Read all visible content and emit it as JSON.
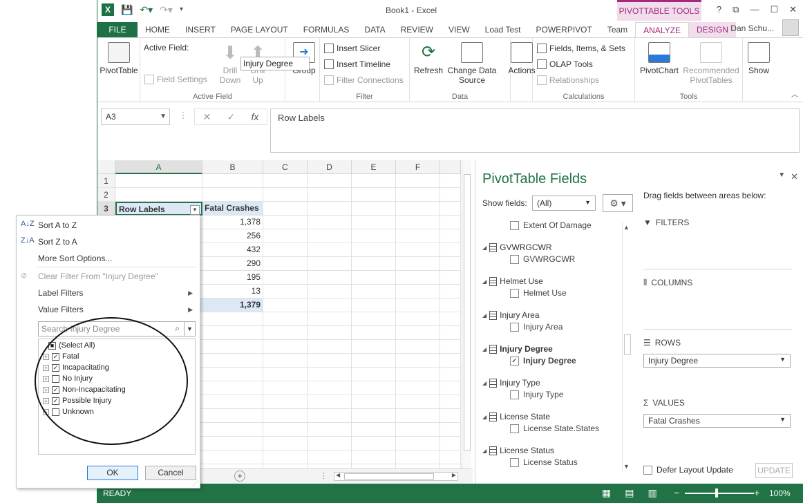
{
  "app": {
    "document_title": "Book1 - Excel",
    "context_band": "PIVOTTABLE TOOLS",
    "user": "Dan Schu...",
    "window_controls": [
      "?",
      "⧉",
      "—",
      "☐",
      "✕"
    ]
  },
  "tabs": [
    "FILE",
    "HOME",
    "INSERT",
    "PAGE LAYOUT",
    "FORMULAS",
    "DATA",
    "REVIEW",
    "VIEW",
    "Load Test",
    "POWERPIVOT",
    "Team",
    "ANALYZE",
    "DESIGN"
  ],
  "ribbon": {
    "pivottable_btn": "PivotTable",
    "active_field_label": "Active Field:",
    "active_field_value": "Injury Degree",
    "field_settings": "Field Settings",
    "drill_down": "Drill Down",
    "drill_up": "Drill Up",
    "active_field_group": "Active Field",
    "group_btn": "Group",
    "insert_slicer": "Insert Slicer",
    "insert_timeline": "Insert Timeline",
    "filter_connections": "Filter Connections",
    "filter_group": "Filter",
    "refresh": "Refresh",
    "change_data_source": "Change Data Source",
    "data_group": "Data",
    "actions": "Actions",
    "fields_items_sets": "Fields, Items, & Sets",
    "olap_tools": "OLAP Tools",
    "relationships": "Relationships",
    "calculations_group": "Calculations",
    "pivotchart": "PivotChart",
    "recommended_pivottables": "Recommended PivotTables",
    "tools_group": "Tools",
    "show": "Show"
  },
  "formula_bar": {
    "name_box": "A3",
    "formula": "Row Labels"
  },
  "grid": {
    "columns": [
      "A",
      "B",
      "C",
      "D",
      "E",
      "F"
    ],
    "rows": [
      "1",
      "2",
      "3"
    ],
    "a3": "Row Labels",
    "b3": "Fatal Crashes",
    "values": [
      "1,378",
      "256",
      "432",
      "290",
      "195",
      "13"
    ],
    "total": "1,379"
  },
  "status": {
    "text": "READY",
    "zoom": "100%"
  },
  "pane": {
    "title": "PivotTable Fields",
    "show_fields_label": "Show fields:",
    "show_fields_value": "(All)",
    "drag_label": "Drag fields between areas below:",
    "fields": [
      {
        "group": "",
        "field": "Extent Of Damage",
        "checked": false,
        "bold": false
      },
      {
        "group": "GVWRGCWR",
        "field": "GVWRGCWR",
        "checked": false,
        "bold": false
      },
      {
        "group": "Helmet Use",
        "field": "Helmet Use",
        "checked": false,
        "bold": false
      },
      {
        "group": "Injury Area",
        "field": "Injury Area",
        "checked": false,
        "bold": false
      },
      {
        "group": "Injury Degree",
        "field": "Injury Degree",
        "checked": true,
        "bold": true
      },
      {
        "group": "Injury Type",
        "field": "Injury Type",
        "checked": false,
        "bold": false
      },
      {
        "group": "License State",
        "field": "License State.States",
        "checked": false,
        "bold": false
      },
      {
        "group": "License Status",
        "field": "License Status",
        "checked": false,
        "bold": false
      }
    ],
    "areas": {
      "filters": "FILTERS",
      "columns": "COLUMNS",
      "rows": "ROWS",
      "rows_item": "Injury Degree",
      "values": "VALUES",
      "values_item": "Fatal Crashes"
    },
    "defer_label": "Defer Layout Update",
    "update_btn": "UPDATE"
  },
  "filter_menu": {
    "sort_az": "Sort A to Z",
    "sort_za": "Sort Z to A",
    "more_sort": "More Sort Options...",
    "clear_filter": "Clear Filter From \"Injury Degree\"",
    "label_filters": "Label Filters",
    "value_filters": "Value Filters",
    "search_placeholder": "Search Injury Degree",
    "items": [
      {
        "label": "(Select All)",
        "state": "partial"
      },
      {
        "label": "Fatal",
        "state": "checked"
      },
      {
        "label": "Incapacitating",
        "state": "checked"
      },
      {
        "label": "No Injury",
        "state": "unchecked"
      },
      {
        "label": "Non-Incapacitating",
        "state": "checked"
      },
      {
        "label": "Possible Injury",
        "state": "checked"
      },
      {
        "label": "Unknown",
        "state": "unchecked"
      }
    ],
    "ok": "OK",
    "cancel": "Cancel"
  },
  "colors": {
    "excel_green": "#217346",
    "pivot_accent": "#a32b7d",
    "pivot_band": "#f1ddec",
    "pivot_header_fill": "#dde8f6"
  }
}
